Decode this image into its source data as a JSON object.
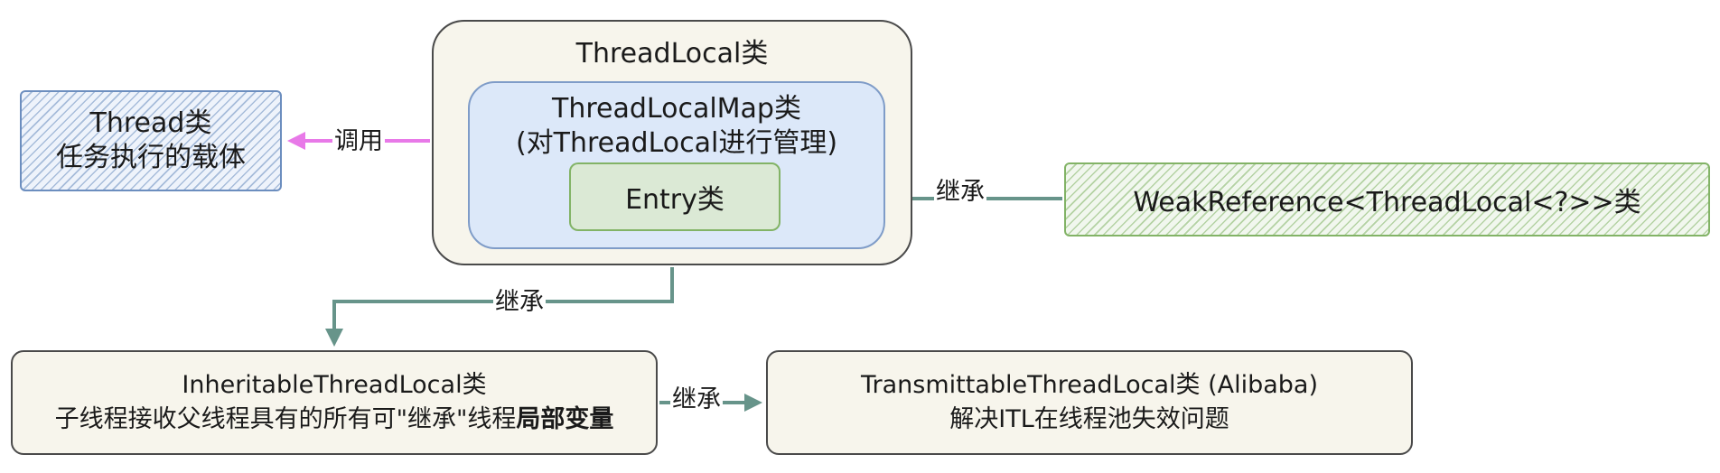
{
  "threadlocal": {
    "title": "ThreadLocal类"
  },
  "threadlocalmap": {
    "line1": "ThreadLocalMap类",
    "line2": "(对ThreadLocal进行管理)"
  },
  "entry": {
    "label": "Entry类"
  },
  "thread": {
    "line1": "Thread类",
    "line2": "任务执行的载体"
  },
  "weakref": {
    "label": "WeakReference<ThreadLocal<?>>类"
  },
  "inheritable": {
    "line1": "InheritableThreadLocal类",
    "line2_normal": "子线程接收父线程具有的所有可\"继承\"线程",
    "line2_bold": "局部变量"
  },
  "transmittable": {
    "line1": "TransmittableThreadLocal类 (Alibaba)",
    "line2": "解决ITL在线程池失效问题"
  },
  "edges": {
    "call_label": "调用",
    "inherit_entry_label": "继承",
    "inherit_down_label": "继承",
    "inherit_right_label": "继承"
  },
  "colors": {
    "call_arrow": "#e879e8",
    "inherit_arrow": "#67948a"
  }
}
